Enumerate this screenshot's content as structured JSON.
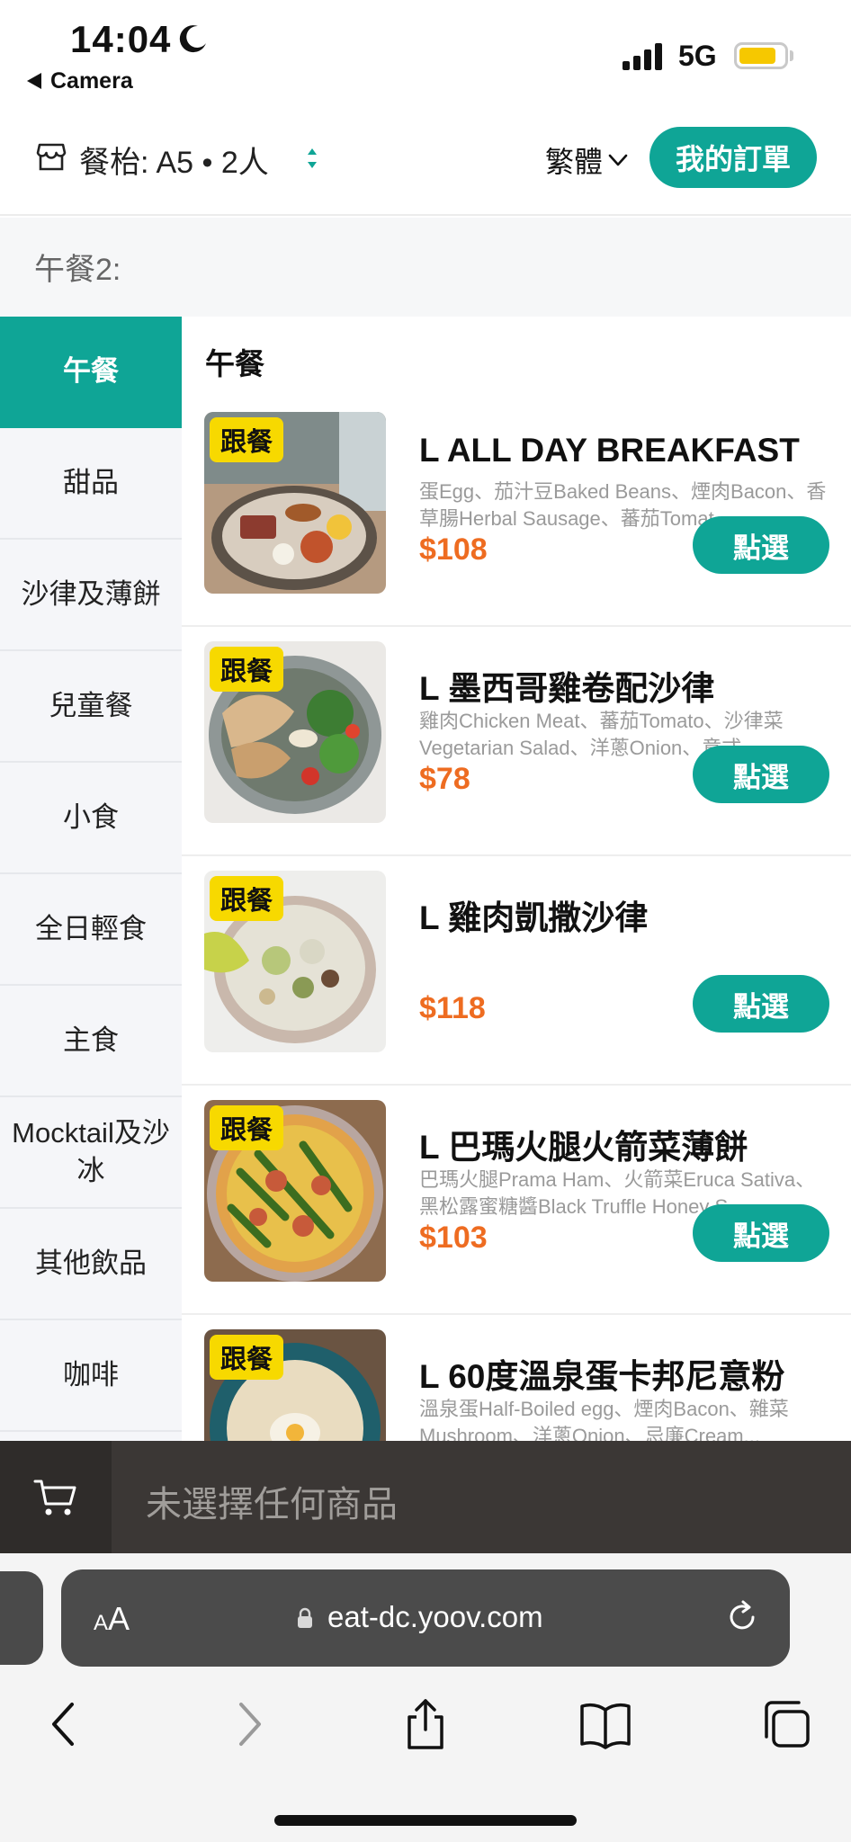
{
  "status": {
    "time": "14:04",
    "back_app": "Camera",
    "network": "5G"
  },
  "header": {
    "table_label": "餐枱:",
    "table_value": "A5 • 2人",
    "language": "繁體",
    "orders_button": "我的訂單"
  },
  "category_title": "午餐2:",
  "sidebar": {
    "items": [
      {
        "label": "午餐"
      },
      {
        "label": "甜品"
      },
      {
        "label": "沙律及薄餅"
      },
      {
        "label": "兒童餐"
      },
      {
        "label": "小食"
      },
      {
        "label": "全日輕食"
      },
      {
        "label": "主食"
      },
      {
        "label": "Mocktail及沙冰"
      },
      {
        "label": "其他飲品"
      },
      {
        "label": "咖啡"
      }
    ]
  },
  "main": {
    "section_heading": "午餐",
    "items": [
      {
        "tag": "跟餐",
        "name": "L ALL DAY BREAKFAST",
        "description": "蛋Egg、茄汁豆Baked Beans、煙肉Bacon、香草腸Herbal Sausage、蕃茄Tomat...",
        "price": "$108",
        "button": "點選"
      },
      {
        "tag": "跟餐",
        "name": "L 墨西哥雞卷配沙律",
        "description": "雞肉Chicken Meat、蕃茄Tomato、沙律菜Vegetarian Salad、洋蔥Onion、意式...",
        "price": "$78",
        "button": "點選"
      },
      {
        "tag": "跟餐",
        "name": "L 雞肉凱撒沙律",
        "description": "",
        "price": "$118",
        "button": "點選"
      },
      {
        "tag": "跟餐",
        "name": "L 巴瑪火腿火箭菜薄餅",
        "description": "巴瑪火腿Prama Ham、火箭菜Eruca Sativa、黑松露蜜糖醬Black Truffle Honey S...",
        "price": "$103",
        "button": "點選"
      },
      {
        "tag": "跟餐",
        "name": "L 60度溫泉蛋卡邦尼意粉",
        "description": "溫泉蛋Half-Boiled egg、煙肉Bacon、雜菜Mushroom、洋蔥Onion、忌廉Cream...",
        "price": "",
        "button": ""
      }
    ]
  },
  "cart": {
    "empty_text": "未選擇任何商品"
  },
  "browser": {
    "aa_label": "AA",
    "url": "eat-dc.yoov.com"
  },
  "colors": {
    "accent": "#0fa596",
    "price": "#ee6c21",
    "tag": "#f7d900"
  }
}
